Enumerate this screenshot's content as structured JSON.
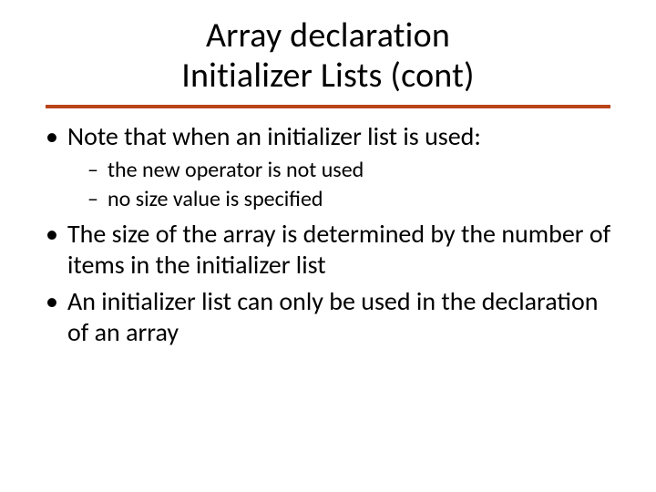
{
  "title": {
    "line1": "Array declaration",
    "line2": "Initializer Lists (cont)"
  },
  "bullets": [
    {
      "text": "Note that when an initializer list is used:",
      "sub": [
        "the new operator is not used",
        "no size value is specified"
      ]
    },
    {
      "text": "The size of the array is determined by the number of items in the initializer list",
      "sub": []
    },
    {
      "text": "An initializer list can only be used in the declaration of an array",
      "sub": []
    }
  ]
}
